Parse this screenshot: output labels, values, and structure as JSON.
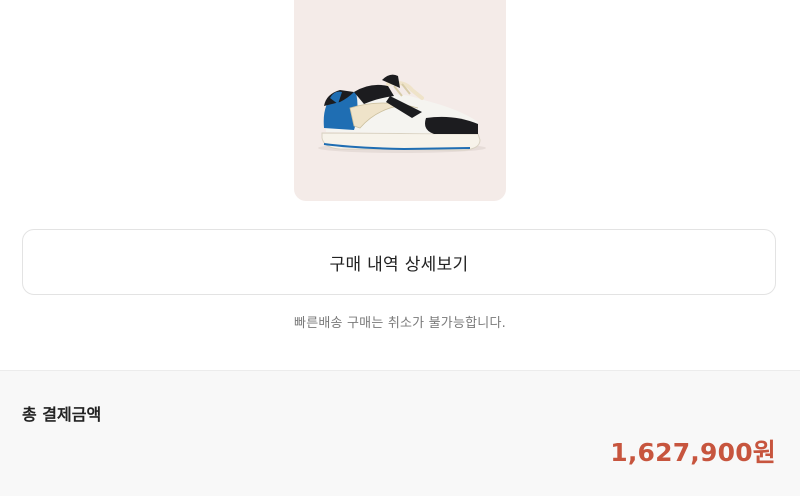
{
  "product": {
    "image_icon": "sneaker-image"
  },
  "detail_button": {
    "label": "구매 내역 상세보기"
  },
  "notice": {
    "text": "빠른배송 구매는 취소가 불가능합니다."
  },
  "total": {
    "label": "총 결제금액",
    "amount": "1,627,900원"
  },
  "colors": {
    "card_background": "#f4ebe8",
    "accent_price": "#c7553e",
    "section_background": "#f8f8f8",
    "shoe_blue": "#1f6eb3",
    "shoe_black": "#1c1c1f",
    "shoe_cream": "#efe3c9"
  }
}
